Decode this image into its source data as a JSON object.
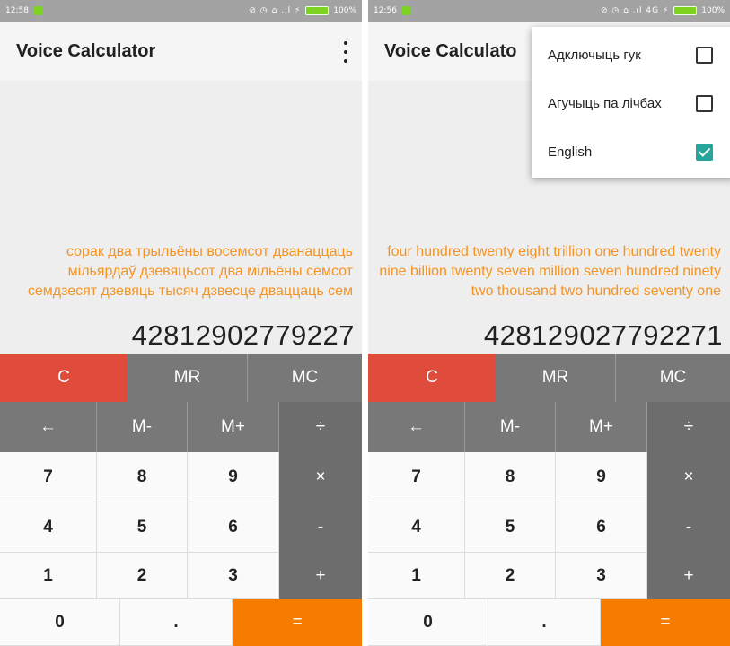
{
  "left": {
    "status": {
      "time": "12:58",
      "icons": "⊘ ◷ ⌂ .ıl ⚡",
      "battery": "100%"
    },
    "app_title": "Voice Calculator",
    "words": "сорак два трыльёны восемсот дванаццаць мільярдаў дзевяцьсот два мільёны семсот семдзесят дзевяць тысяч дзвесце дваццаць сем",
    "number": "42812902779227"
  },
  "right": {
    "status": {
      "time": "12:56",
      "icons": "⊘ ◷ ⌂ .ıl 4G ⚡",
      "battery": "100%"
    },
    "app_title": "Voice Calculato",
    "words": "four hundred twenty eight trillion one hundred twenty nine billion twenty seven million seven hundred ninety two thousand two hundred seventy one",
    "number": "428129027792271",
    "menu": [
      {
        "label": "Адключыць гук",
        "checked": false
      },
      {
        "label": "Агучыць па лічбах",
        "checked": false
      },
      {
        "label": "English",
        "checked": true
      }
    ]
  },
  "keys": {
    "clear": "C",
    "mr": "MR",
    "mc": "MC",
    "back": "←",
    "mminus": "M-",
    "mplus": "M+",
    "divide": "÷",
    "seven": "7",
    "eight": "8",
    "nine": "9",
    "multiply": "×",
    "four": "4",
    "five": "5",
    "six": "6",
    "minus": "-",
    "one": "1",
    "two": "2",
    "three": "3",
    "plus": "+",
    "zero": "0",
    "dot": ".",
    "equals": "="
  },
  "colors": {
    "accent_orange": "#f57c00",
    "words_orange": "#f39424",
    "clear_red": "#e04c3b",
    "check_teal": "#26a69a"
  }
}
